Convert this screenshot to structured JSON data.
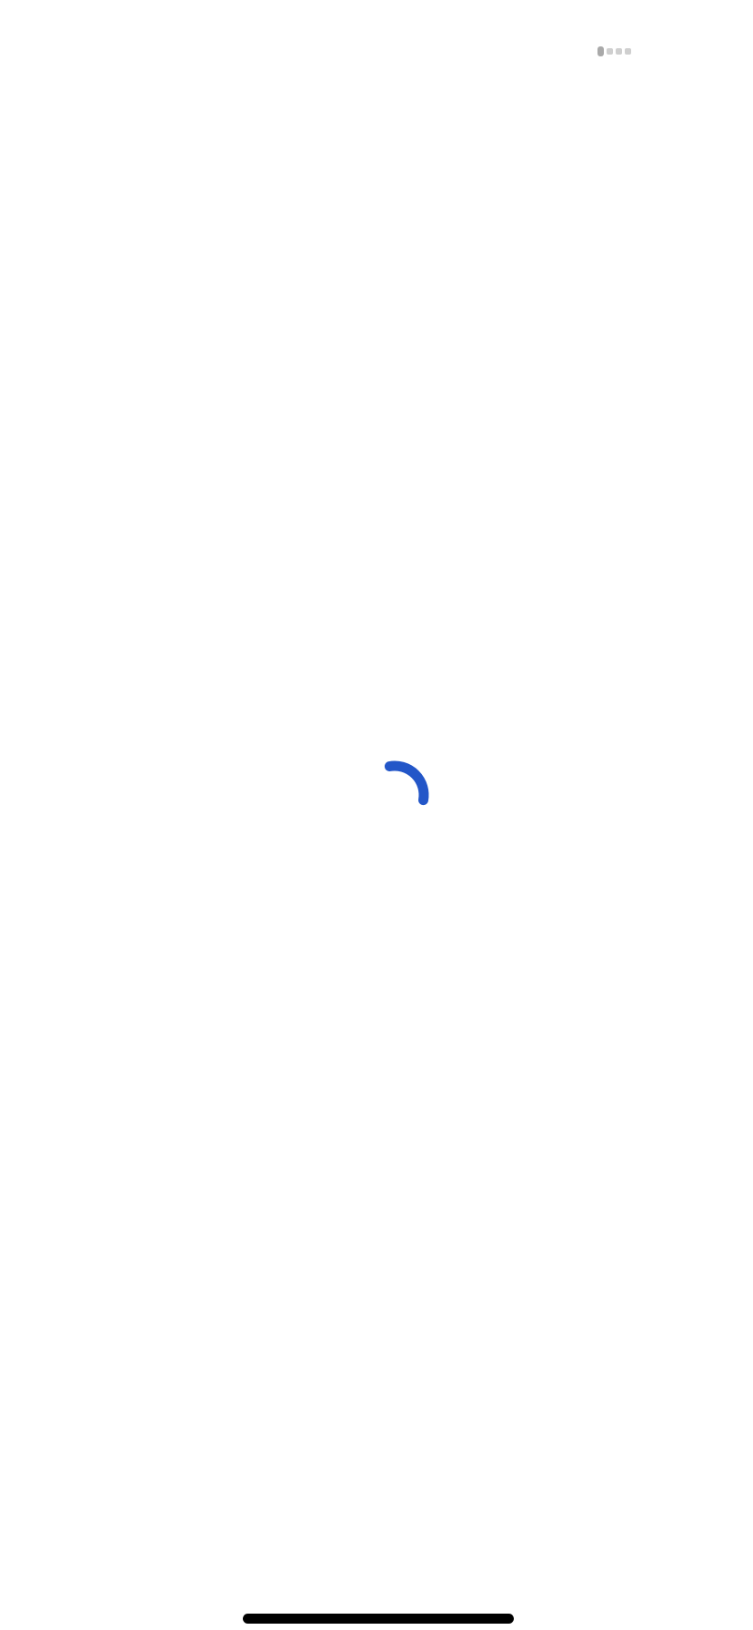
{
  "screen": {
    "state": "loading"
  },
  "page_indicator": {
    "count": 4,
    "active_index": 0
  },
  "spinner": {
    "icon": "loading-spinner-icon",
    "color": "#2356c8",
    "sweep_degrees": 110,
    "start_angle_degrees": -100
  },
  "home_indicator": {
    "color": "#000000"
  }
}
